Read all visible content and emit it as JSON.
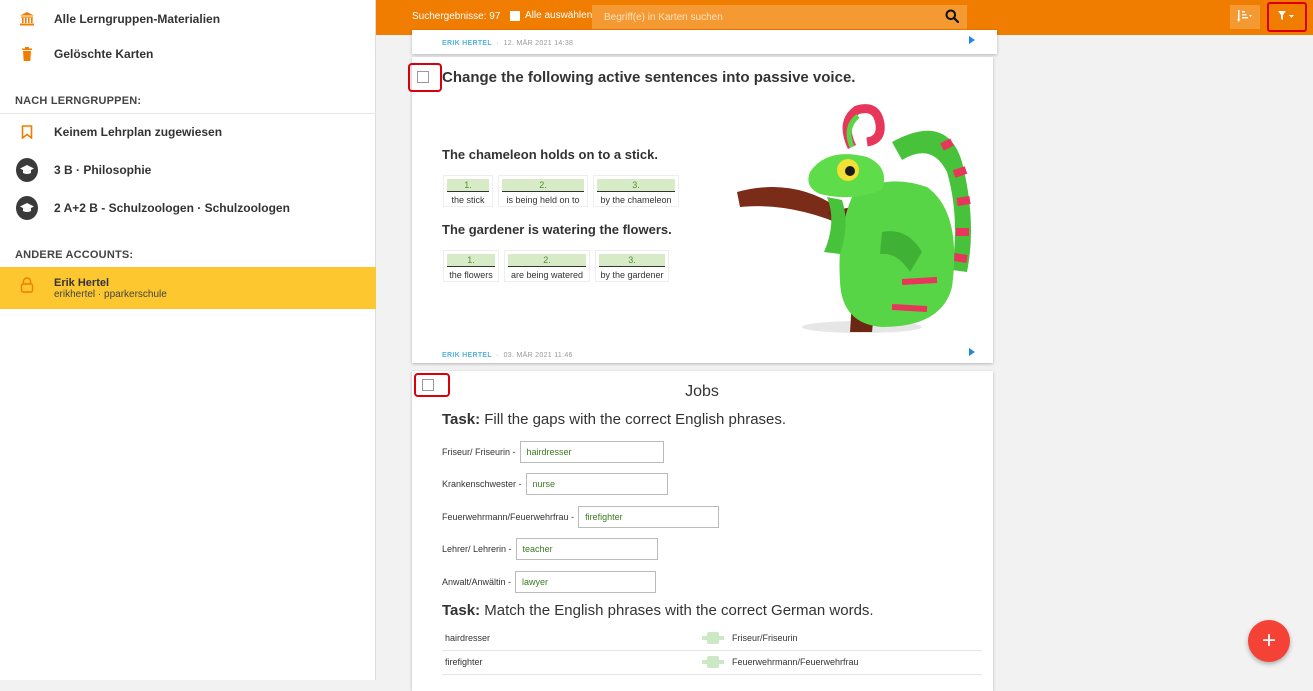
{
  "sidebar": {
    "all_materials": "Alle Lerngruppen-Materialien",
    "deleted_cards": "Gelöschte Karten",
    "section_groups": "NACH LERNGRUPPEN:",
    "groups": [
      {
        "label": "Keinem Lehrplan zugewiesen"
      },
      {
        "label": "3 B · Philosophie"
      },
      {
        "label": "2 A+2 B - Schulzoologen · Schulzoologen"
      }
    ],
    "section_accounts": "ANDERE ACCOUNTS:",
    "account": {
      "name": "Erik Hertel",
      "sub": "erikhertel · pparkerschule"
    }
  },
  "topbar": {
    "results": "Suchergebnisse: 97",
    "select_all": "Alle auswählen",
    "search_placeholder": "Begriff(e) in Karten suchen"
  },
  "card1": {
    "author": "ERIK HERTEL",
    "date": "12. MÄR 2021 14:38"
  },
  "card2": {
    "title": "Change the following active sentences into passive voice.",
    "sentence1": "The chameleon holds on to a stick.",
    "blanks1": [
      {
        "num": "1.",
        "answer": "the stick"
      },
      {
        "num": "2.",
        "answer": "is being held on to"
      },
      {
        "num": "3.",
        "answer": "by the chameleon"
      }
    ],
    "sentence2": "The gardener is watering the flowers.",
    "blanks2": [
      {
        "num": "1.",
        "answer": "the flowers"
      },
      {
        "num": "2.",
        "answer": "are being watered"
      },
      {
        "num": "3.",
        "answer": "by the gardener"
      }
    ],
    "author": "ERIK HERTEL",
    "date": "03. MÄR 2021 11:46"
  },
  "card3": {
    "title": "Jobs",
    "task1_bold": "Task:",
    "task1_text": " Fill the gaps with the correct English phrases.",
    "gaps": [
      {
        "label": "Friseur/ Friseurin -",
        "value": "hairdresser"
      },
      {
        "label": "Krankenschwester -",
        "value": "nurse"
      },
      {
        "label": "Feuerwehrmann/Feuerwehrfrau -",
        "value": "firefighter"
      },
      {
        "label": "Lehrer/ Lehrerin -",
        "value": "teacher"
      },
      {
        "label": "Anwalt/Anwältin -",
        "value": "lawyer"
      }
    ],
    "task2_bold": "Task:",
    "task2_text": " Match the English phrases with the correct German words.",
    "matches": [
      {
        "en": "hairdresser",
        "de": "Friseur/Friseurin"
      },
      {
        "en": "firefighter",
        "de": "Feuerwehrmann/Feuerwehrfrau"
      }
    ]
  },
  "fab": {
    "label": "+"
  },
  "colors": {
    "accent": "#f07c00",
    "highlight": "#fdc72f",
    "fab": "#f44336"
  }
}
